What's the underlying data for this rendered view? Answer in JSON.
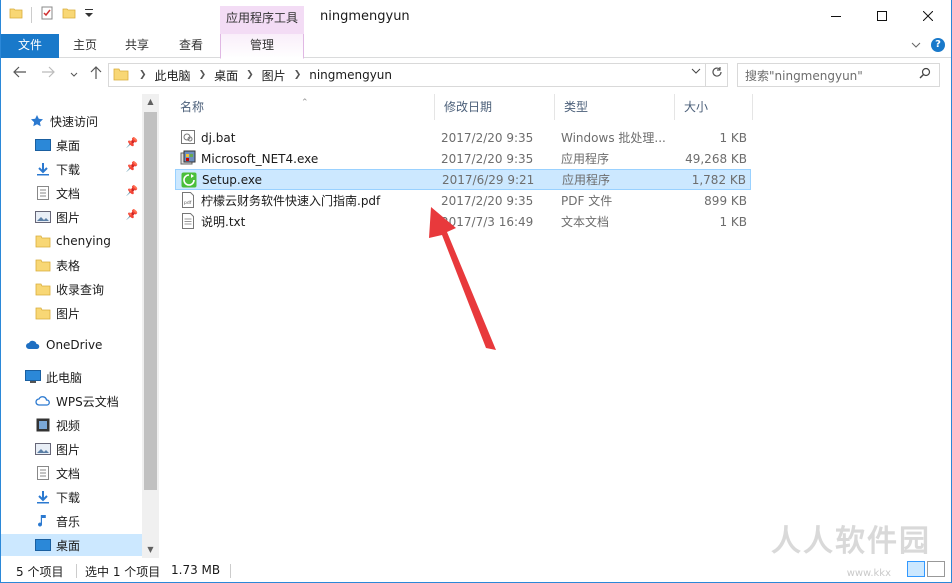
{
  "title_bar": {
    "contextual_tab_group": "应用程序工具",
    "window_title": "ningmengyun"
  },
  "ribbon": {
    "tabs": [
      {
        "label": "文件"
      },
      {
        "label": "主页"
      },
      {
        "label": "共享"
      },
      {
        "label": "查看"
      },
      {
        "label": "管理"
      }
    ]
  },
  "address_bar": {
    "crumbs": [
      "此电脑",
      "桌面",
      "图片",
      "ningmengyun"
    ],
    "search_placeholder": "搜索\"ningmengyun\""
  },
  "nav_pane": {
    "quick_access": {
      "label": "快速访问"
    },
    "items": [
      {
        "label": "桌面",
        "icon": "desktop-icon",
        "pinned": true
      },
      {
        "label": "下载",
        "icon": "download-icon",
        "pinned": true
      },
      {
        "label": "文档",
        "icon": "document-icon",
        "pinned": true
      },
      {
        "label": "图片",
        "icon": "pictures-icon",
        "pinned": true
      },
      {
        "label": "chenying",
        "icon": "folder-icon",
        "pinned": false
      },
      {
        "label": "表格",
        "icon": "folder-icon",
        "pinned": false
      },
      {
        "label": "收录查询",
        "icon": "folder-icon",
        "pinned": false
      },
      {
        "label": "图片",
        "icon": "folder-icon",
        "pinned": false
      }
    ],
    "onedrive": {
      "label": "OneDrive"
    },
    "this_pc": {
      "label": "此电脑"
    },
    "pc_items": [
      {
        "label": "WPS云文档",
        "icon": "cloud-icon"
      },
      {
        "label": "视频",
        "icon": "video-icon"
      },
      {
        "label": "图片",
        "icon": "pictures-icon"
      },
      {
        "label": "文档",
        "icon": "document-icon"
      },
      {
        "label": "下载",
        "icon": "download-icon"
      },
      {
        "label": "音乐",
        "icon": "music-icon"
      },
      {
        "label": "桌面",
        "icon": "desktop-icon"
      }
    ]
  },
  "file_list": {
    "columns": {
      "name": "名称",
      "date": "修改日期",
      "type": "类型",
      "size": "大小"
    },
    "rows": [
      {
        "name": "dj.bat",
        "date": "2017/2/20 9:35",
        "type": "Windows 批处理...",
        "size": "1 KB",
        "icon": "batch-file-icon",
        "selected": false
      },
      {
        "name": "Microsoft_NET4.exe",
        "date": "2017/2/20 9:35",
        "type": "应用程序",
        "size": "49,268 KB",
        "icon": "installer-icon",
        "selected": false
      },
      {
        "name": "Setup.exe",
        "date": "2017/6/29 9:21",
        "type": "应用程序",
        "size": "1,782 KB",
        "icon": "setup-app-icon",
        "selected": true
      },
      {
        "name": "柠檬云财务软件快速入门指南.pdf",
        "date": "2017/2/20 9:35",
        "type": "PDF 文件",
        "size": "899 KB",
        "icon": "pdf-file-icon",
        "selected": false
      },
      {
        "name": "说明.txt",
        "date": "2017/7/3 16:49",
        "type": "文本文档",
        "size": "1 KB",
        "icon": "text-file-icon",
        "selected": false
      }
    ]
  },
  "status_bar": {
    "item_count": "5 个项目",
    "selection": "选中 1 个项目",
    "selection_size": "1.73 MB"
  },
  "watermark": {
    "text": "人人软件园",
    "sub": "www.kkx"
  },
  "colors": {
    "accent": "#1979ca",
    "selection": "#cce8ff",
    "context_tab": "#f3dcf5",
    "arrow": "#e8393c"
  }
}
